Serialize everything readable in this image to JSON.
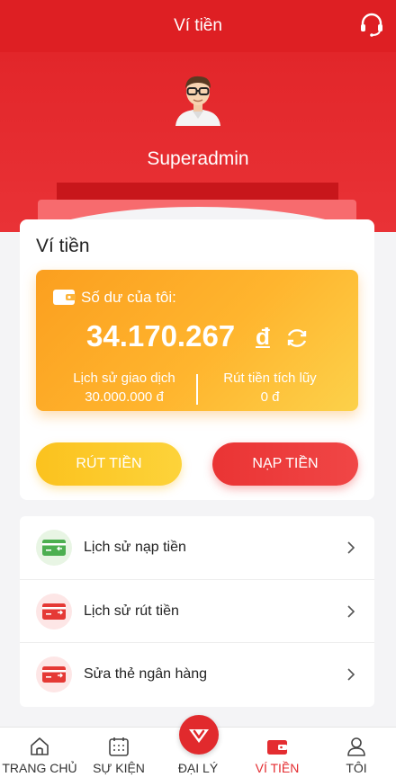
{
  "header": {
    "title": "Ví tiền",
    "support_icon": "headset-icon"
  },
  "profile": {
    "username": "Superadmin",
    "avatar_icon": "user-avatar"
  },
  "wallet": {
    "title": "Ví tiền",
    "balance_label": "Số dư của tôi:",
    "balance_amount": "34.170.267",
    "currency": "đ",
    "history_label": "Lịch sử giao dịch",
    "history_value": "30.000.000 đ",
    "accumulated_label": "Rút tiền tích lũy",
    "accumulated_value": "0 đ",
    "withdraw_button": "RÚT TIỀN",
    "deposit_button": "NẠP TIỀN"
  },
  "menu": [
    {
      "label": "Lịch sử nạp tiền",
      "icon": "deposit-card-icon",
      "color": "#4caf50"
    },
    {
      "label": "Lịch sử rút tiền",
      "icon": "withdraw-card-icon",
      "color": "#e53935"
    },
    {
      "label": "Sửa thẻ ngân hàng",
      "icon": "bank-card-icon",
      "color": "#e53935"
    }
  ],
  "nav": [
    {
      "label": "TRANG CHỦ",
      "icon": "home-icon"
    },
    {
      "label": "SỰ KIỆN",
      "icon": "calendar-icon"
    },
    {
      "label": "ĐẠI LÝ",
      "icon": "agency-icon"
    },
    {
      "label": "VÍ TIỀN",
      "icon": "wallet-icon",
      "active": true
    },
    {
      "label": "TÔI",
      "icon": "user-icon"
    }
  ],
  "colors": {
    "brand_red": "#de1f23",
    "accent_orange": "#fba020",
    "active_nav": "#e42d31"
  }
}
